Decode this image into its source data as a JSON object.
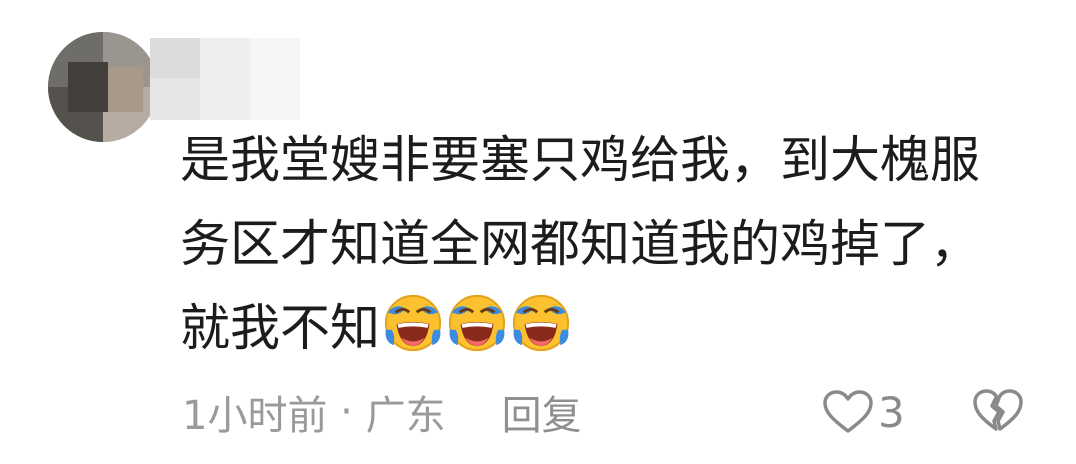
{
  "comment": {
    "text_line1": "是我堂嫂非要塞只鸡给我，到大槐服",
    "text_line2": "务区才知道全网都知道我的鸡掉了，",
    "text_line3": "就我不知",
    "emoji_names": [
      "crying-laughing-emoji",
      "crying-laughing-emoji",
      "crying-laughing-emoji"
    ]
  },
  "meta": {
    "time": "1小时前",
    "separator": " · ",
    "location": "广东",
    "reply_label": "回复"
  },
  "actions": {
    "like_icon": "heart-outline-icon",
    "like_count": "3",
    "dislike_icon": "broken-heart-icon"
  },
  "colors": {
    "text": "#1c1c1c",
    "meta": "#9a9a9a",
    "icon": "#8a8a8a"
  }
}
